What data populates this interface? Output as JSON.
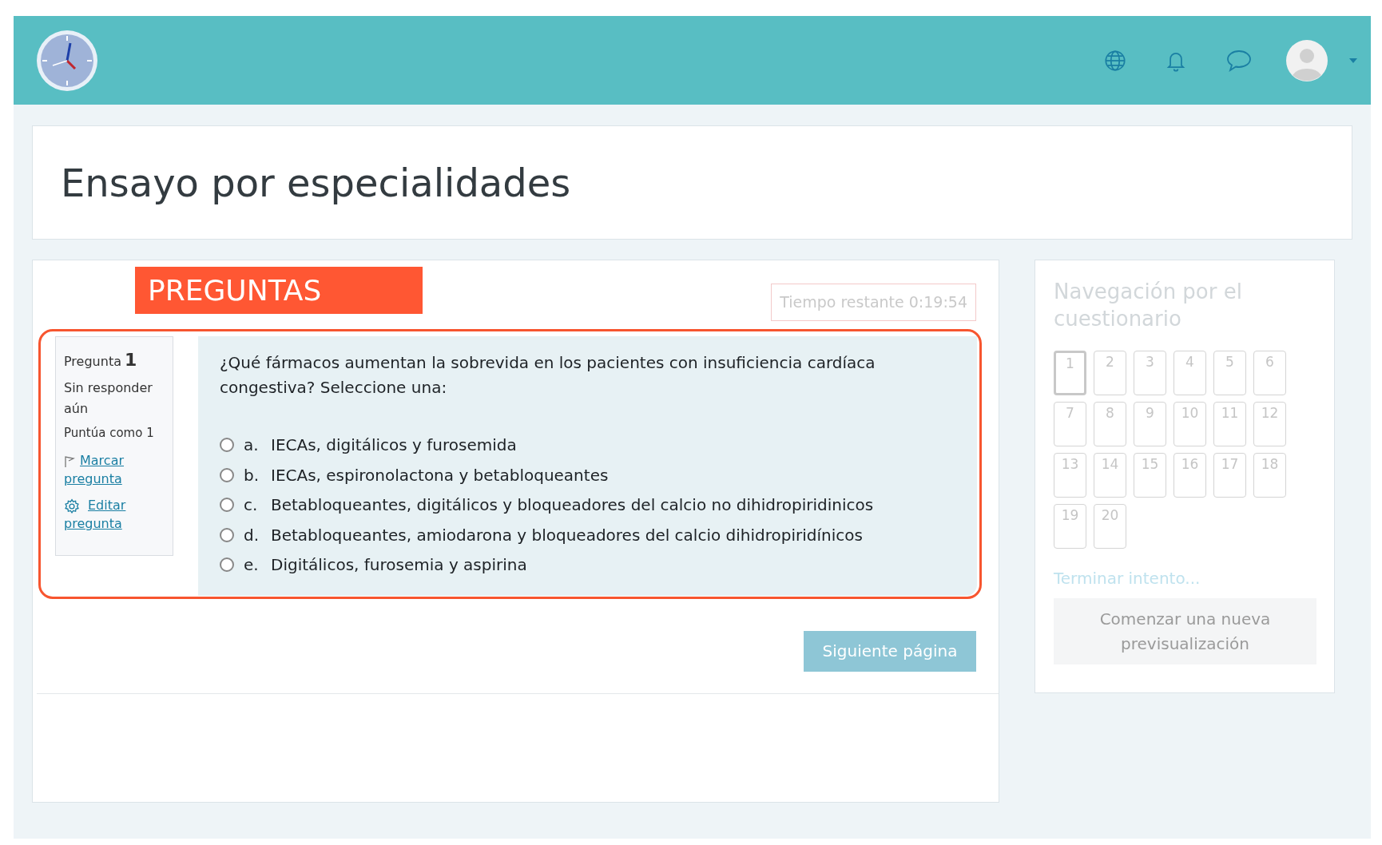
{
  "page_title": "Ensayo por especialidades",
  "banner": "PREGUNTAS",
  "timer": "Tiempo restante 0:19:54",
  "question_info": {
    "label": "Pregunta",
    "number": "1",
    "status": "Sin responder aún",
    "points": "Puntúa como 1",
    "actions": [
      {
        "kind": "flag",
        "label": "Marcar pregunta"
      },
      {
        "kind": "edit",
        "label": "Editar pregunta"
      }
    ]
  },
  "question": {
    "text": "¿Qué fármacos aumentan la sobrevida en los pacientes con insuficiencia cardíaca congestiva? Seleccione una:",
    "options": [
      {
        "letter": "a.",
        "text": "IECAs, digitálicos y furosemida",
        "checked": false
      },
      {
        "letter": "b.",
        "text": "IECAs, espironolactona y betabloqueantes",
        "checked": false
      },
      {
        "letter": "c.",
        "text": "Betabloqueantes, digitálicos y bloqueadores del calcio no dihidropiridinicos",
        "checked": false
      },
      {
        "letter": "d.",
        "text": "Betabloqueantes, amiodarona y bloqueadores del calcio dihidropiridínicos",
        "checked": false
      },
      {
        "letter": "e.",
        "text": "Digitálicos, furosemia y aspirina",
        "checked": false
      }
    ]
  },
  "next_button": "Siguiente página",
  "navigation": {
    "title": "Navegación por el cuestionario",
    "questions": [
      {
        "label": "1",
        "selected": true
      },
      {
        "label": "2",
        "selected": false
      },
      {
        "label": "3",
        "selected": false
      },
      {
        "label": "4",
        "selected": false
      },
      {
        "label": "5",
        "selected": false
      },
      {
        "label": "6",
        "selected": false
      },
      {
        "label": "7",
        "selected": false
      },
      {
        "label": "8",
        "selected": false
      },
      {
        "label": "9",
        "selected": false
      },
      {
        "label": "10",
        "selected": false
      },
      {
        "label": "11",
        "selected": false
      },
      {
        "label": "12",
        "selected": false
      },
      {
        "label": "13",
        "selected": false
      },
      {
        "label": "14",
        "selected": false
      },
      {
        "label": "15",
        "selected": false
      },
      {
        "label": "16",
        "selected": false
      },
      {
        "label": "17",
        "selected": false
      },
      {
        "label": "18",
        "selected": false
      },
      {
        "label": "19",
        "selected": false
      },
      {
        "label": "20",
        "selected": false
      }
    ],
    "finish_link": "Terminar intento...",
    "restart_button": "Comenzar una nueva previsualización"
  }
}
